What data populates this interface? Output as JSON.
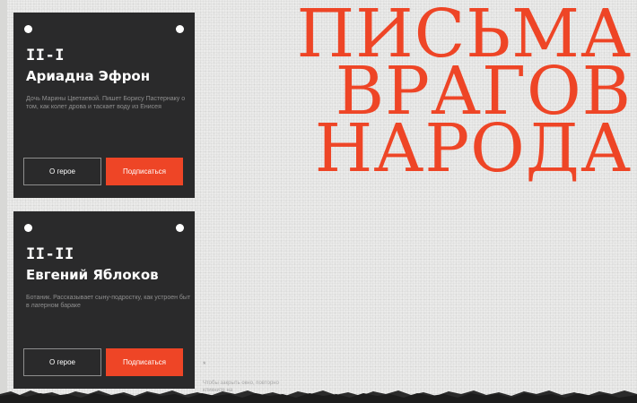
{
  "cards": [
    {
      "roman": "II-I",
      "name": "Ариадна Эфрон",
      "description": "Дочь Марины Цветаевой. Пишет Борису Пастернаку о том, как колет дрова и таскает воду из Енисея",
      "secondary_label": "О герое",
      "primary_label": "Подписаться"
    },
    {
      "roman": "II-II",
      "name": "Евгений Яблоков",
      "description": "Ботаник. Рассказывает сыну-подростку, как устроен быт в лагерном бараке",
      "secondary_label": "О герое",
      "primary_label": "Подписаться"
    }
  ],
  "title_lines": [
    "ПИСЬМА",
    "ВРАГОВ",
    "НАРОДА"
  ],
  "footer": {
    "star": "*",
    "hint": "Чтобы закрыть окно, повторно кликните на"
  },
  "colors": {
    "accent": "#ee4526",
    "card_bg": "#2a2a2b",
    "page_bg": "#ebebea"
  }
}
